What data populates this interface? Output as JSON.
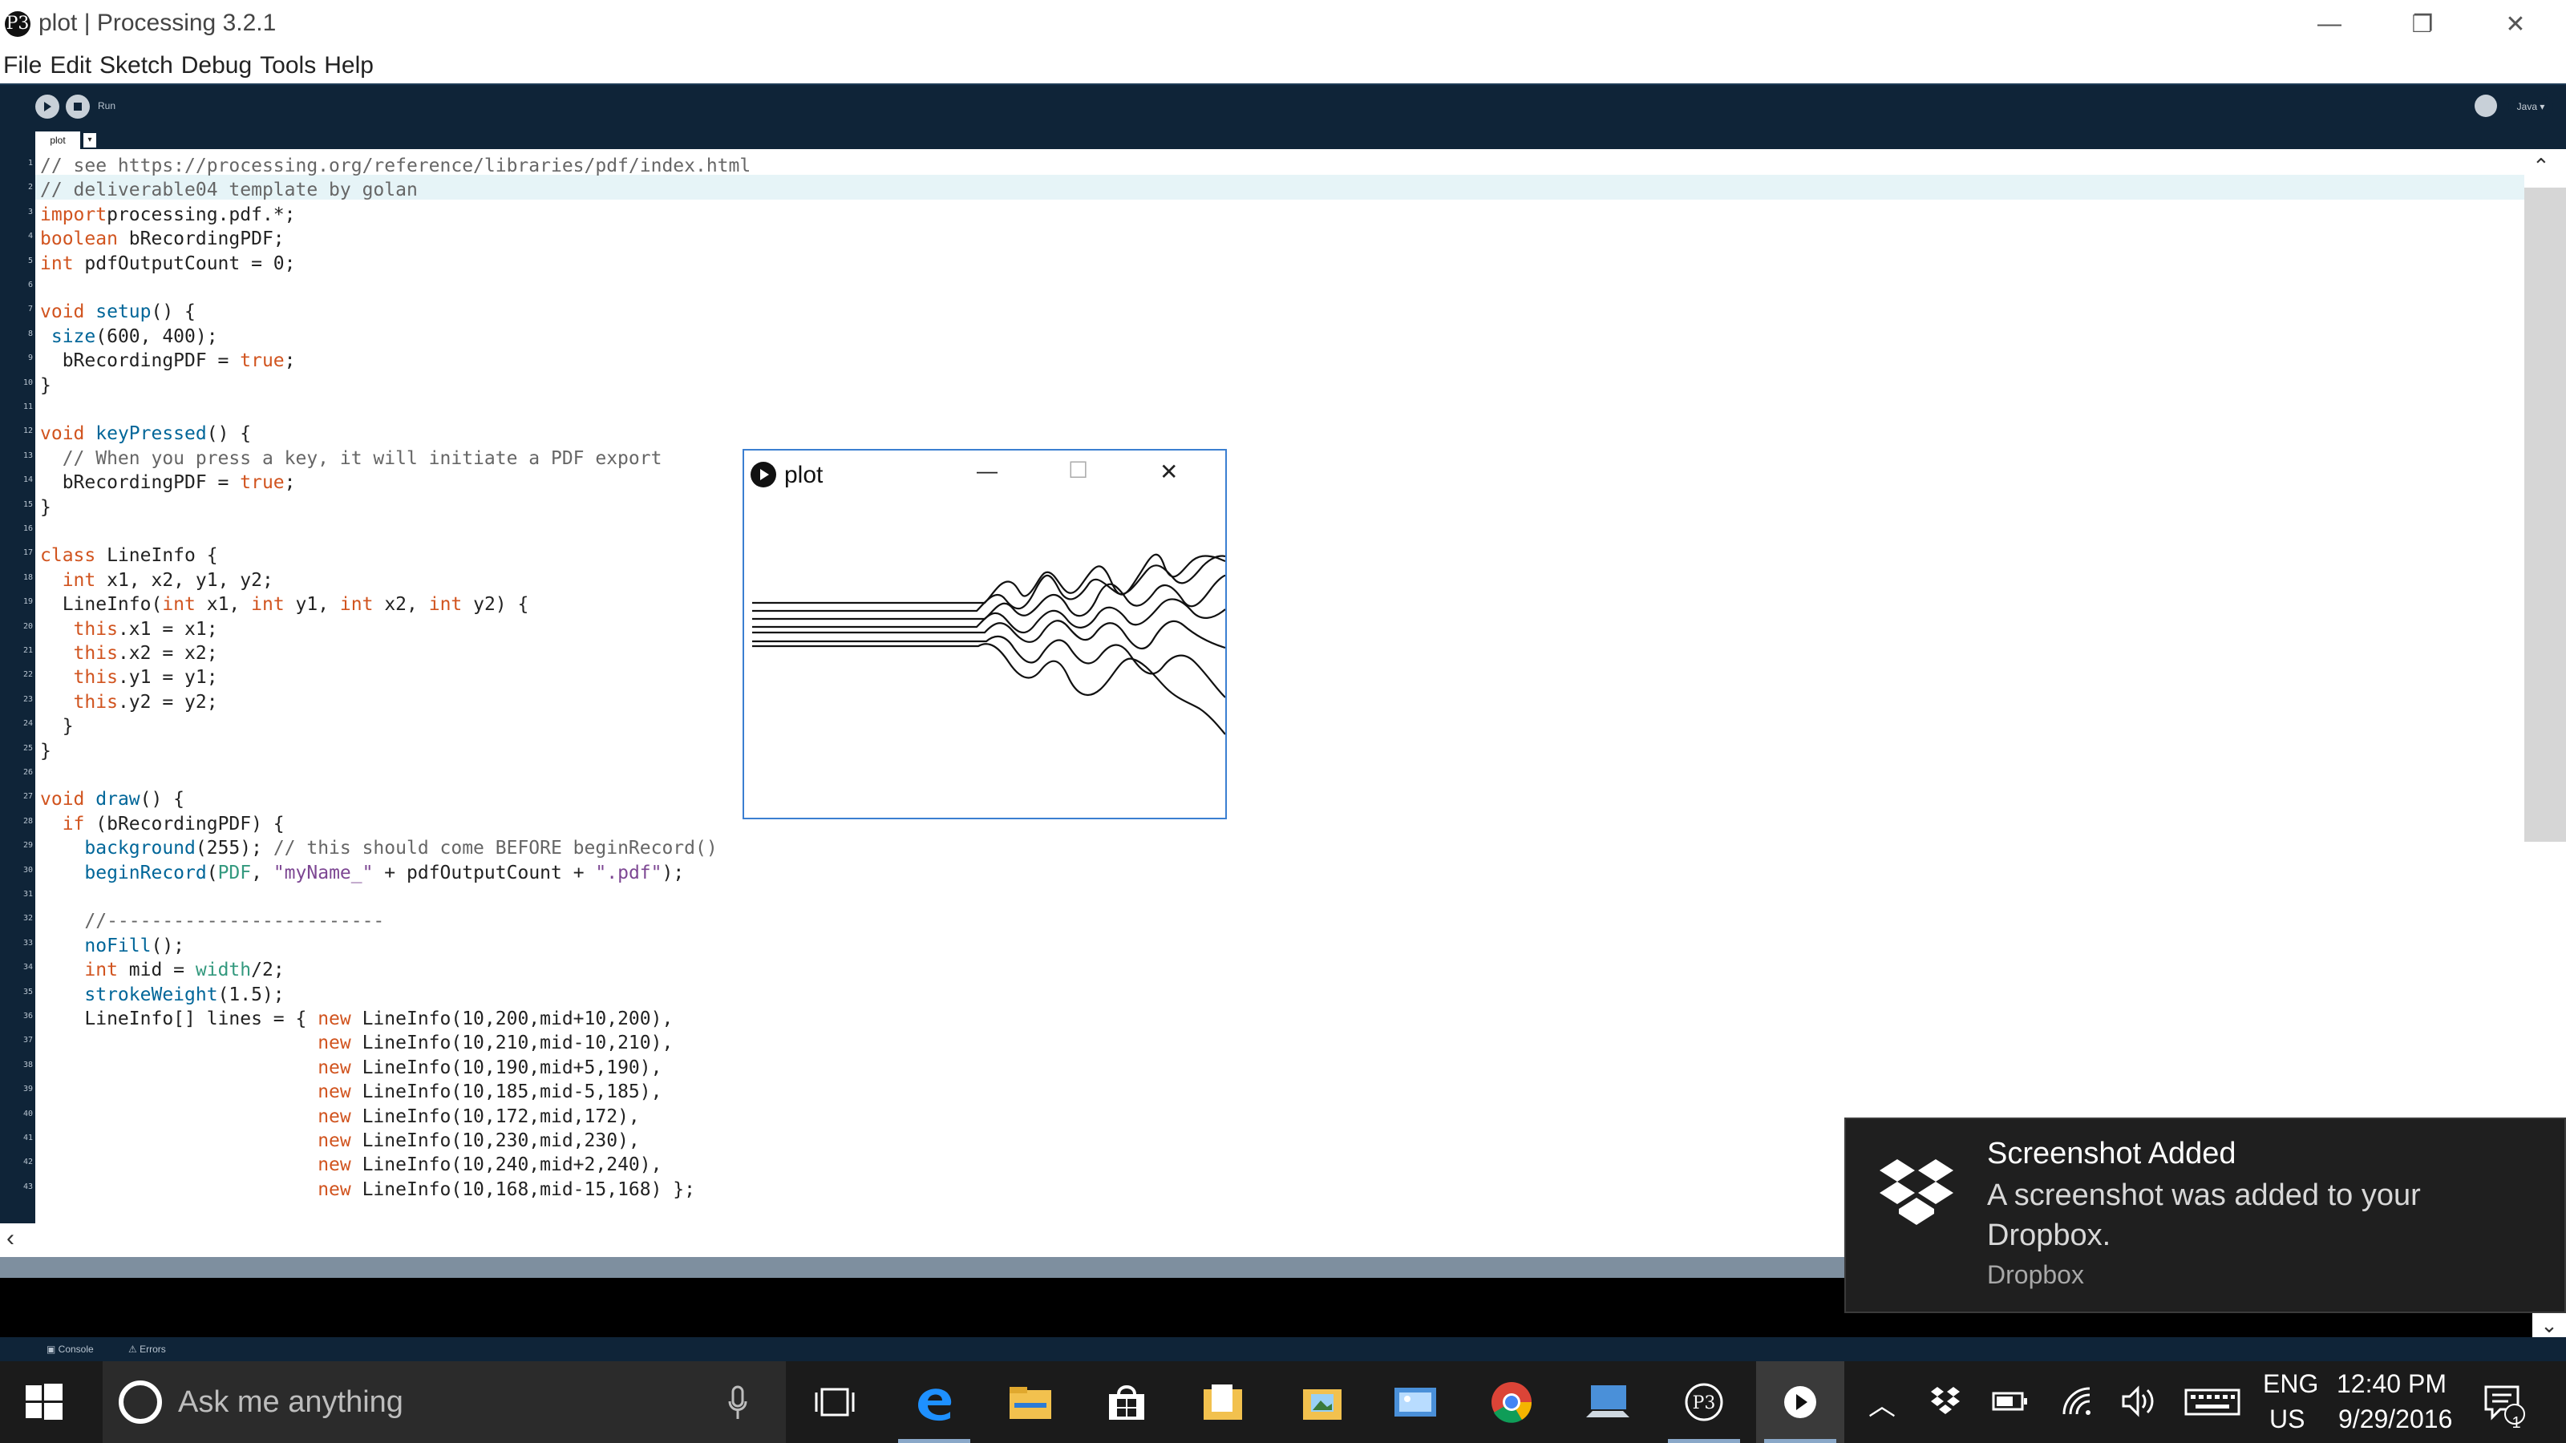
{
  "window": {
    "app_logo": "P3",
    "title": "plot | Processing 3.2.1",
    "controls": {
      "minimize": "—",
      "maximize": "❐",
      "close": "✕"
    }
  },
  "menu": [
    "File",
    "Edit",
    "Sketch",
    "Debug",
    "Tools",
    "Help"
  ],
  "toolbar": {
    "run_label": "Run",
    "mode_label": "Java ▾"
  },
  "tabs": [
    {
      "label": "plot"
    }
  ],
  "editor": {
    "line_numbers": [
      "1",
      "2",
      "3",
      "4",
      "5",
      "6",
      "7",
      "8",
      "9",
      "10",
      "11",
      "12",
      "13",
      "14",
      "15",
      "16",
      "17",
      "18",
      "19",
      "20",
      "21",
      "22",
      "23",
      "24",
      "25",
      "26",
      "27",
      "28",
      "29",
      "30",
      "31",
      "32",
      "33",
      "34",
      "35",
      "36",
      "37",
      "38",
      "39",
      "40",
      "41",
      "42",
      "43"
    ],
    "lines": [
      [
        [
          "cm",
          "// see https://processing.org/reference/libraries/pdf/index.html"
        ]
      ],
      [
        [
          "cm",
          "// deliverable04 template by golan"
        ]
      ],
      [
        [
          "kw",
          "import"
        ],
        [
          "",
          "processing.pdf.*;"
        ]
      ],
      [
        [
          "kw",
          "boolean"
        ],
        [
          "",
          " bRecordingPDF;"
        ]
      ],
      [
        [
          "kw",
          "int"
        ],
        [
          "",
          " pdfOutputCount = 0;"
        ]
      ],
      [],
      [
        [
          "kw",
          "void"
        ],
        [
          "",
          "",
          " "
        ],
        [
          "fn",
          "setup"
        ],
        [
          "",
          "() {"
        ]
      ],
      [
        [
          "",
          "",
          " "
        ],
        [
          "fn",
          "size"
        ],
        [
          "",
          "(600, 400);"
        ]
      ],
      [
        [
          "",
          "  bRecordingPDF = "
        ],
        [
          "kw",
          "true"
        ],
        [
          "",
          ";"
        ]
      ],
      [
        [
          "",
          "}"
        ]
      ],
      [],
      [
        [
          "kw",
          "void"
        ],
        [
          "",
          "",
          " "
        ],
        [
          "fn",
          "keyPressed"
        ],
        [
          "",
          "() {"
        ]
      ],
      [
        [
          "cm",
          "  // When you press a key, it will initiate a PDF export"
        ]
      ],
      [
        [
          "",
          "  bRecordingPDF = "
        ],
        [
          "kw",
          "true"
        ],
        [
          "",
          ";"
        ]
      ],
      [
        [
          "",
          "}"
        ]
      ],
      [],
      [
        [
          "kw",
          "class"
        ],
        [
          "",
          " LineInfo {"
        ]
      ],
      [
        [
          "",
          "  "
        ],
        [
          "kw",
          "int"
        ],
        [
          "",
          " x1, x2, y1, y2;"
        ]
      ],
      [
        [
          "",
          "  LineInfo("
        ],
        [
          "kw",
          "int"
        ],
        [
          "",
          " x1, "
        ],
        [
          "kw",
          "int"
        ],
        [
          "",
          " y1, "
        ],
        [
          "kw",
          "int"
        ],
        [
          "",
          " x2, "
        ],
        [
          "kw",
          "int"
        ],
        [
          "",
          " y2) {"
        ]
      ],
      [
        [
          "",
          "   "
        ],
        [
          "kw",
          "this"
        ],
        [
          "",
          ".x1 = x1;"
        ]
      ],
      [
        [
          "",
          "   "
        ],
        [
          "kw",
          "this"
        ],
        [
          "",
          ".x2 = x2;"
        ]
      ],
      [
        [
          "",
          "   "
        ],
        [
          "kw",
          "this"
        ],
        [
          "",
          ".y1 = y1;"
        ]
      ],
      [
        [
          "",
          "   "
        ],
        [
          "kw",
          "this"
        ],
        [
          "",
          ".y2 = y2;"
        ]
      ],
      [
        [
          "",
          "  }"
        ]
      ],
      [
        [
          "",
          "}"
        ]
      ],
      [],
      [
        [
          "kw",
          "void"
        ],
        [
          "",
          "",
          " "
        ],
        [
          "fn",
          "draw"
        ],
        [
          "",
          "() {"
        ]
      ],
      [
        [
          "",
          "  "
        ],
        [
          "kw",
          "if"
        ],
        [
          "",
          " (bRecordingPDF) {"
        ]
      ],
      [
        [
          "",
          "    "
        ],
        [
          "fn",
          "background"
        ],
        [
          "",
          "(255); "
        ],
        [
          "cm",
          "// this should come BEFORE beginRecord()"
        ]
      ],
      [
        [
          "",
          "    "
        ],
        [
          "fn",
          "beginRecord"
        ],
        [
          "",
          "("
        ],
        [
          "bi",
          "PDF"
        ],
        [
          "",
          ", "
        ],
        [
          "st",
          "\"myName_\""
        ],
        [
          "",
          " + pdfOutputCount + "
        ],
        [
          "st",
          "\".pdf\""
        ],
        [
          "",
          ");"
        ]
      ],
      [],
      [
        [
          "cm",
          "    //-------------------------"
        ]
      ],
      [
        [
          "",
          "    "
        ],
        [
          "fn",
          "noFill"
        ],
        [
          "",
          "();"
        ]
      ],
      [
        [
          "",
          "    "
        ],
        [
          "kw",
          "int"
        ],
        [
          "",
          " mid = "
        ],
        [
          "bi",
          "width"
        ],
        [
          "",
          "/2;"
        ]
      ],
      [
        [
          "",
          "    "
        ],
        [
          "fn",
          "strokeWeight"
        ],
        [
          "",
          "(1.5);"
        ]
      ],
      [
        [
          "",
          "    LineInfo[] lines = { "
        ],
        [
          "kw",
          "new"
        ],
        [
          "",
          " LineInfo(10,200,mid+10,200),"
        ]
      ],
      [
        [
          "",
          "                         "
        ],
        [
          "kw",
          "new"
        ],
        [
          "",
          " LineInfo(10,210,mid-10,210),"
        ]
      ],
      [
        [
          "",
          "                         "
        ],
        [
          "kw",
          "new"
        ],
        [
          "",
          " LineInfo(10,190,mid+5,190),"
        ]
      ],
      [
        [
          "",
          "                         "
        ],
        [
          "kw",
          "new"
        ],
        [
          "",
          " LineInfo(10,185,mid-5,185),"
        ]
      ],
      [
        [
          "",
          "                         "
        ],
        [
          "kw",
          "new"
        ],
        [
          "",
          " LineInfo(10,172,mid,172),"
        ]
      ],
      [
        [
          "",
          "                         "
        ],
        [
          "kw",
          "new"
        ],
        [
          "",
          " LineInfo(10,230,mid,230),"
        ]
      ],
      [
        [
          "",
          "                         "
        ],
        [
          "kw",
          "new"
        ],
        [
          "",
          " LineInfo(10,240,mid+2,240),"
        ]
      ],
      [
        [
          "",
          "                         "
        ],
        [
          "kw",
          "new"
        ],
        [
          "",
          " LineInfo(10,168,mid-15,168) };"
        ]
      ]
    ]
  },
  "console_tabs": {
    "console": "Console",
    "errors": "Errors"
  },
  "sketch_window": {
    "title": "plot",
    "controls": {
      "minimize": "—",
      "maximize": "☐",
      "close": "✕"
    }
  },
  "notification": {
    "title": "Screenshot Added",
    "body": "A screenshot was added to your Dropbox.",
    "source": "Dropbox"
  },
  "taskbar": {
    "search_placeholder": "Ask me anything",
    "icons": [
      "microphone-icon",
      "task-view-icon",
      "edge-icon",
      "file-explorer-icon",
      "store-icon",
      "documents-folder-icon",
      "pictures-folder-icon",
      "photo-viewer-icon",
      "chrome-icon",
      "remote-desktop-icon",
      "processing-icon",
      "processing-sketch-icon"
    ],
    "lang_top": "ENG",
    "lang_bottom": "US",
    "time": "12:40 PM",
    "date": "9/29/2016",
    "notification_count": "1"
  }
}
